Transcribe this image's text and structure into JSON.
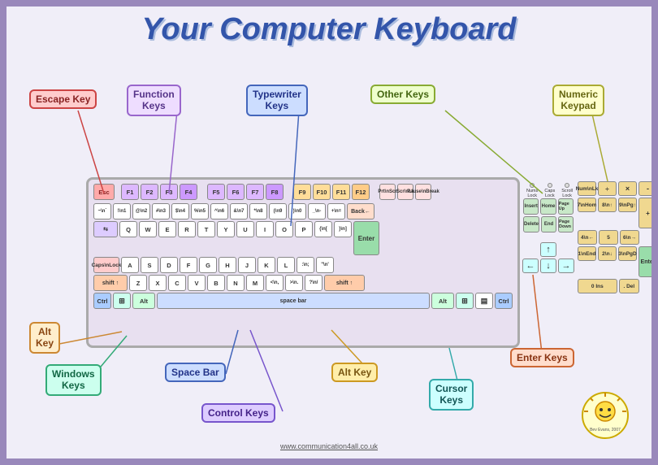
{
  "title": "Your Computer Keyboard",
  "labels": {
    "escape": "Escape Key",
    "function": "Function\nKeys",
    "typewriter": "Typewriter\nKeys",
    "other": "Other Keys",
    "numeric": "Numeric\nKeypad",
    "alt": "Alt\nKey",
    "windows": "Windows\nKeys",
    "spacebar": "Space Bar",
    "control": "Control Keys",
    "altkey": "Alt Key",
    "cursor": "Cursor\nKeys",
    "enter": "Enter Keys"
  },
  "copyright": "www.communication4all.co.uk",
  "credit": "Bev Evans, 2007",
  "function_keys": [
    "F1",
    "F2",
    "F3",
    "F4",
    "F5",
    "F6",
    "F7",
    "F8",
    "F9",
    "F10",
    "F11",
    "F12"
  ],
  "row1_keys": [
    "~\n`",
    "!\n1",
    "@\n2",
    "#\n3",
    "$\n4",
    "%\n5",
    "^\n6",
    "&\n7",
    "*\n8",
    "(\n9",
    ")\n0",
    "_\n-",
    "+\n=",
    "Backspace"
  ],
  "row2_keys": [
    "Tab",
    "Q",
    "W",
    "E",
    "R",
    "T",
    "Y",
    "U",
    "I",
    "O",
    "P",
    "{\n[",
    "}\n]",
    "|\n\\"
  ],
  "row3_keys": [
    "Caps\nLock",
    "A",
    "S",
    "D",
    "F",
    "G",
    "H",
    "J",
    "K",
    "L",
    ":\n;",
    "\"\n'",
    "Enter"
  ],
  "row4_keys": [
    "shift",
    "Z",
    "X",
    "C",
    "V",
    "B",
    "N",
    "M",
    "<\n,",
    ">\n.",
    "?\n/",
    "shift"
  ],
  "row5_keys": [
    "Ctrl",
    "",
    "Alt",
    "space bar",
    "Alt",
    "",
    "Ctrl"
  ],
  "nav_keys": [
    "Insert",
    "Home",
    "Page\nUp",
    "Delete",
    "End",
    "Page\nDown"
  ],
  "arrow_keys": [
    "↑",
    "←",
    "↓",
    "→"
  ],
  "numpad_keys": [
    "Num\nLk",
    "÷",
    "-",
    "7\nHome",
    "8\n↑",
    "9\nPgUp",
    "+",
    "4\n←",
    "5",
    "6\n→",
    "1\nEnd",
    "2\n↓",
    "3\nPgDn",
    "Enter",
    "0\nIns",
    ".\nDel"
  ],
  "indicators": [
    "Nums\nLock",
    "Caps\nLock",
    "Scroll\nLock"
  ]
}
